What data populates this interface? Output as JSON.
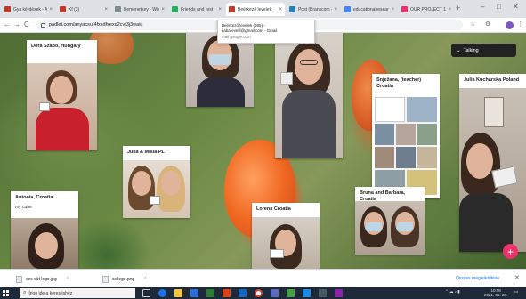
{
  "tabs": [
    {
      "title": "Gya kérdések - Af",
      "color": "#c0392b",
      "active": false
    },
    {
      "title": "Kf (3)",
      "color": "#c0392b",
      "active": false
    },
    {
      "title": "Bemenetkey - Wiki",
      "color": "#7f8c8d",
      "active": false
    },
    {
      "title": "Friends and rest",
      "color": "#27ae60",
      "active": false
    },
    {
      "title": "Beérkező levelek",
      "color": "#c0392b",
      "active": true
    },
    {
      "title": "Post (Branscom - C",
      "color": "#2980b9",
      "active": false
    },
    {
      "title": "educationalresear",
      "color": "#4285f4",
      "active": false
    },
    {
      "title": "OUR PROJECT 11 1",
      "color": "#e8336d",
      "active": false
    }
  ],
  "browser": {
    "url": "padlet.com/anyacsu/4fxsdfsexq2cvt3j3waiu",
    "new_tab": "+",
    "minimize": "–",
    "maximize": "□",
    "close": "✕",
    "back": "←",
    "forward": "→",
    "reload": "C"
  },
  "tooltip": {
    "line1": "Beérkező levelek (985) -",
    "line2": "kabarevelll@gmail.com - Gmail",
    "line3": "mail.google.com"
  },
  "board": {
    "talking_label": "Talking",
    "fab": "+",
    "cards": {
      "dora": {
        "title": "Dóra Szabó, Hungary"
      },
      "snjezana": {
        "title": "Snježana, (teacher)\nCroatia"
      },
      "julia_kucharska": {
        "title": "Julia Kucharska Poland"
      },
      "julia_misia": {
        "title": "Julia & Misia PL"
      },
      "antonia": {
        "title": "Antonia, Croatia",
        "sub": "my cube"
      },
      "lorena": {
        "title": "Lorena Croatia"
      },
      "bruna": {
        "title": "Bruna and Barbara, Croatia"
      }
    }
  },
  "downloads": [
    {
      "name": "ses süt logo.jpg"
    },
    {
      "name": "ssllogo.png"
    }
  ],
  "downloads_show_all": "Összes megjelenítése",
  "downloads_close": "✕",
  "taskbar": {
    "search_placeholder": "Írjon ide a kereséshez",
    "tray_time": "10:08",
    "tray_date": "2021. 05. 28."
  },
  "colors": {
    "accent": "#e8336d",
    "board_dark": "#4f6e35"
  }
}
